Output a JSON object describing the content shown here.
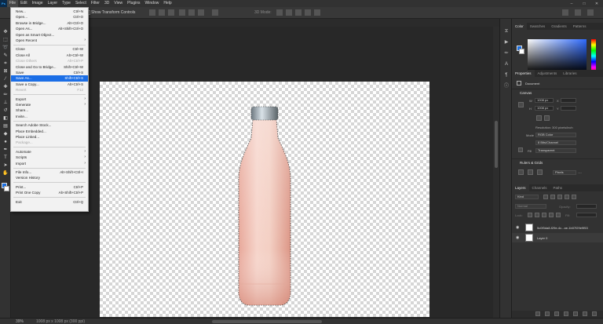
{
  "menubar": {
    "logo": "Ps",
    "items": [
      "File",
      "Edit",
      "Image",
      "Layer",
      "Type",
      "Select",
      "Filter",
      "3D",
      "View",
      "Plugins",
      "Window",
      "Help"
    ],
    "active": "File",
    "window_controls": [
      "–",
      "□",
      "✕"
    ]
  },
  "options_bar": {
    "show_transform_controls": "Show Transform Controls",
    "mode_3d": "3D Mode:"
  },
  "file_menu": [
    {
      "label": "New...",
      "shortcut": "Ctrl+N"
    },
    {
      "label": "Open...",
      "shortcut": "Ctrl+O"
    },
    {
      "label": "Browse in Bridge...",
      "shortcut": "Alt+Ctrl+O"
    },
    {
      "label": "Open As...",
      "shortcut": "Alt+Shift+Ctrl+O"
    },
    {
      "label": "Open as Smart Object...",
      "shortcut": ""
    },
    {
      "label": "Open Recent",
      "shortcut": "",
      "submenu": true
    },
    {
      "sep": true
    },
    {
      "label": "Close",
      "shortcut": "Ctrl+W"
    },
    {
      "label": "Close All",
      "shortcut": "Alt+Ctrl+W"
    },
    {
      "label": "Close Others",
      "shortcut": "Alt+Ctrl+P",
      "disabled": true
    },
    {
      "label": "Close and Go to Bridge...",
      "shortcut": "Shift+Ctrl+W"
    },
    {
      "label": "Save",
      "shortcut": "Ctrl+S"
    },
    {
      "label": "Save As...",
      "shortcut": "Shift+Ctrl+S",
      "highlight": true
    },
    {
      "label": "Save a Copy...",
      "shortcut": "Alt+Ctrl+S"
    },
    {
      "label": "Revert",
      "shortcut": "F12",
      "disabled": true
    },
    {
      "sep": true
    },
    {
      "label": "Export",
      "shortcut": "",
      "submenu": true
    },
    {
      "label": "Generate",
      "shortcut": "",
      "submenu": true
    },
    {
      "label": "Share...",
      "shortcut": ""
    },
    {
      "label": "Invite...",
      "shortcut": ""
    },
    {
      "sep": true
    },
    {
      "label": "Search Adobe Stock...",
      "shortcut": ""
    },
    {
      "label": "Place Embedded...",
      "shortcut": ""
    },
    {
      "label": "Place Linked...",
      "shortcut": ""
    },
    {
      "label": "Package...",
      "shortcut": "",
      "disabled": true
    },
    {
      "sep": true
    },
    {
      "label": "Automate",
      "shortcut": "",
      "submenu": true
    },
    {
      "label": "Scripts",
      "shortcut": "",
      "submenu": true
    },
    {
      "label": "Import",
      "shortcut": "",
      "submenu": true
    },
    {
      "sep": true
    },
    {
      "label": "File Info...",
      "shortcut": "Alt+Shift+Ctrl+I"
    },
    {
      "label": "Version History",
      "shortcut": ""
    },
    {
      "sep": true
    },
    {
      "label": "Print...",
      "shortcut": "Ctrl+P"
    },
    {
      "label": "Print One Copy",
      "shortcut": "Alt+Shift+Ctrl+P"
    },
    {
      "sep": true
    },
    {
      "label": "Exit",
      "shortcut": "Ctrl+Q"
    }
  ],
  "color_panel": {
    "tabs": [
      "Color",
      "Swatches",
      "Gradients",
      "Patterns"
    ],
    "foreground": "#1a6fe3",
    "background": "#ffffff"
  },
  "properties_panel": {
    "tabs": [
      "Properties",
      "Adjustments",
      "Libraries"
    ],
    "document_label": "Document",
    "canvas_title": "Canvas",
    "w_label": "W",
    "w_value": "1008 px",
    "h_label": "H",
    "h_value": "1008 px",
    "x_label": "X",
    "y_label": "Y",
    "resolution": "Resolution: 300 pixels/inch",
    "mode_label": "Mode",
    "mode_value": "RGB Color",
    "bit_depth": "8 Bits/Channel",
    "fill_label": "Fill",
    "fill_value": "Transparent",
    "rulers_title": "Rulers & Grids",
    "rulers_unit": "Pixels"
  },
  "layers_panel": {
    "tabs": [
      "Layers",
      "Channels",
      "Paths"
    ],
    "kind_placeholder": "Kind",
    "blend_mode": "Normal",
    "opacity_label": "Opacity:",
    "lock_label": "Lock:",
    "fill_label": "Fill:",
    "layers": [
      {
        "name": "5c0f3da8-f29e-4c...ae-1b07f29e9f53",
        "selected": false
      },
      {
        "name": "Layer 0",
        "selected": true
      }
    ]
  },
  "status_bar": {
    "zoom": "39%",
    "doc_size": "1008 px x 1008 px (300 ppi)"
  },
  "icons": {
    "toolbar": [
      "move-icon",
      "marquee-icon",
      "lasso-icon",
      "quick-select-icon",
      "crop-icon",
      "frame-icon",
      "eyedropper-icon",
      "healing-icon",
      "brush-icon",
      "stamp-icon",
      "history-brush-icon",
      "eraser-icon",
      "gradient-icon",
      "blur-icon",
      "dodge-icon",
      "pen-icon",
      "type-icon",
      "path-select-icon",
      "rectangle-icon",
      "hand-icon",
      "zoom-icon",
      "more-tools-icon"
    ]
  }
}
